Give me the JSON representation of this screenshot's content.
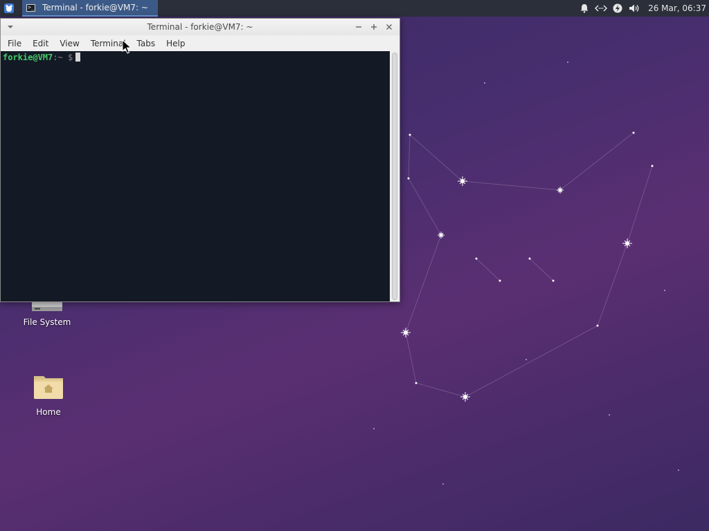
{
  "panel": {
    "task_title": "Terminal - forkie@VM7: ~",
    "clock": "26 Mar, 06:37",
    "tray_icons": [
      "notification-bell-icon",
      "network-icon",
      "power-icon",
      "volume-icon"
    ]
  },
  "window": {
    "title": "Terminal - forkie@VM7: ~",
    "menu": [
      "File",
      "Edit",
      "View",
      "Terminal",
      "Tabs",
      "Help"
    ],
    "prompt_user": "forkie@VM7",
    "prompt_sep": ":",
    "prompt_path": "~",
    "prompt_symbol": "$"
  },
  "desktop": {
    "icons": [
      {
        "label": "File System",
        "icon": "drive-icon"
      },
      {
        "label": "Home",
        "icon": "home-folder-icon"
      }
    ]
  },
  "colors": {
    "terminal_bg": "#131a25",
    "prompt_user": "#47c96a",
    "panel_bg": "#2b2f3a",
    "active_task": "#3c5a87"
  }
}
